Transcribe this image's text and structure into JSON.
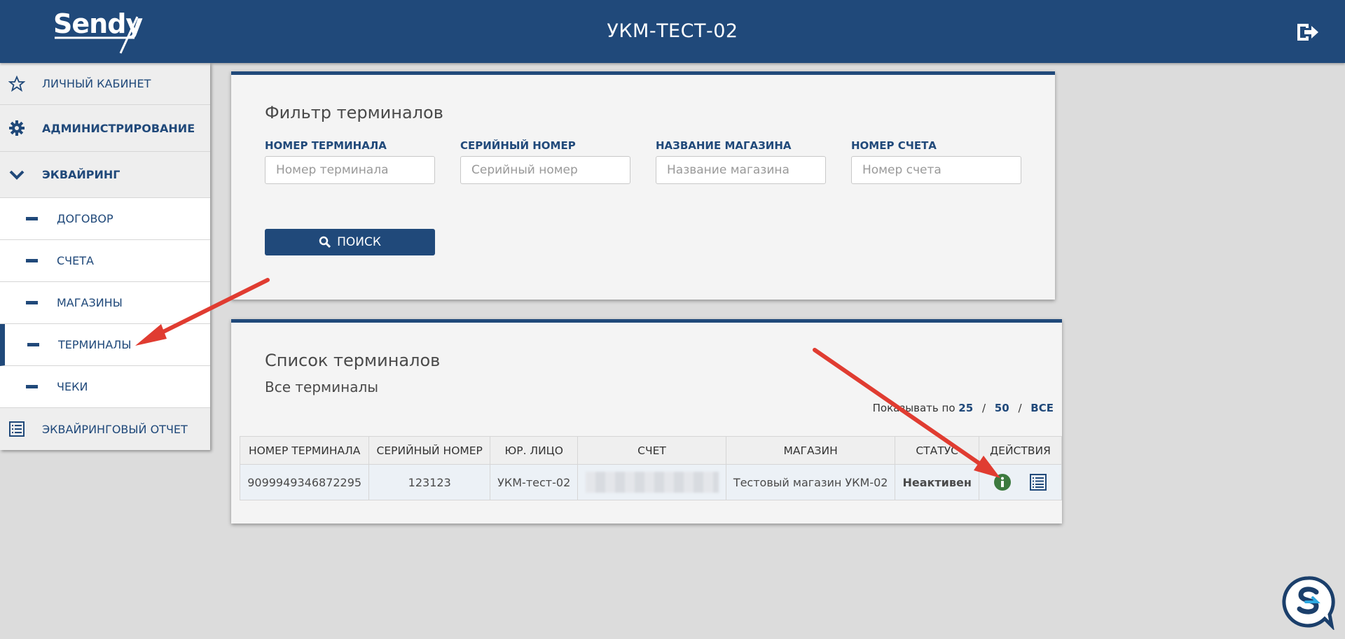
{
  "header": {
    "logo_text": "Sendy",
    "title": "УКМ-ТЕСТ-02"
  },
  "sidebar": {
    "items": [
      {
        "label": "Личный кабинет",
        "icon": "star-icon"
      },
      {
        "label": "Администрирование",
        "icon": "gear-icon"
      },
      {
        "label": "Эквайринг",
        "icon": "chevron-down-icon"
      }
    ],
    "subitems": [
      {
        "label": "Договор"
      },
      {
        "label": "Счета"
      },
      {
        "label": "Магазины"
      },
      {
        "label": "Терминалы"
      },
      {
        "label": "Чеки"
      }
    ],
    "report": {
      "label": "Эквайринговый отчет",
      "icon": "list-icon"
    }
  },
  "filter": {
    "title": "Фильтр терминалов",
    "fields": [
      {
        "label": "Номер терминала",
        "placeholder": "Номер терминала"
      },
      {
        "label": "Серийный номер",
        "placeholder": "Серийный номер"
      },
      {
        "label": "Название магазина",
        "placeholder": "Название магазина"
      },
      {
        "label": "Номер счета",
        "placeholder": "Номер счета"
      }
    ],
    "search_label": "Поиск"
  },
  "list": {
    "title": "Список терминалов",
    "subtitle": "Все терминалы",
    "perpage_label": "Показывать по",
    "perpage_options": [
      "25",
      "50",
      "ВСЕ"
    ],
    "columns": [
      "Номер терминала",
      "Серийный номер",
      "Юр. лицо",
      "Счет",
      "Магазин",
      "Статус",
      "Действия"
    ],
    "rows": [
      {
        "terminal": "9099949346872295",
        "serial": "123123",
        "entity": "УКМ-тест-02",
        "account": "",
        "shop": "Тестовый магазин УКМ-02",
        "status": "Неактивен"
      }
    ]
  },
  "colors": {
    "brand": "#20497a",
    "status_inactive": "#8a6d3b",
    "info_icon": "#3c7a3f",
    "arrow": "#e03c31"
  }
}
